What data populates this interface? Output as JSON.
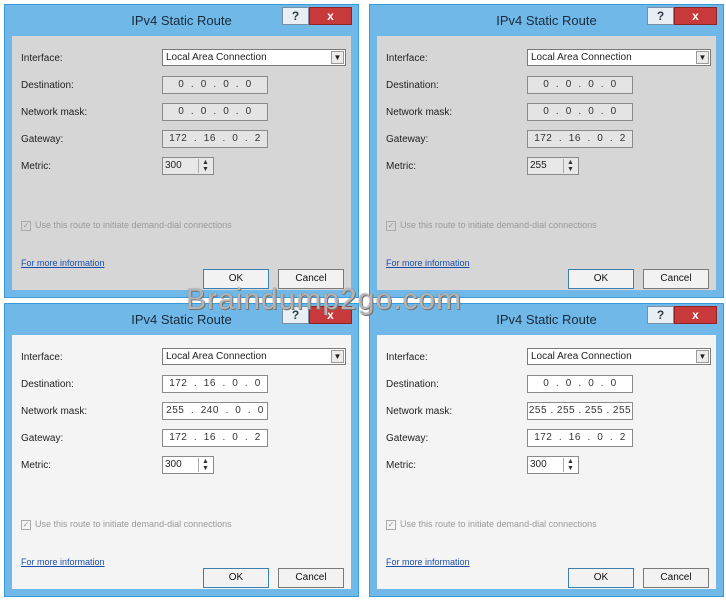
{
  "watermark": "Braindump2go.com",
  "labels": {
    "interface": "Interface:",
    "destination": "Destination:",
    "network_mask": "Network mask:",
    "gateway": "Gateway:",
    "metric": "Metric:",
    "checkbox": "Use this route to initiate demand-dial connections",
    "more_info": "For more information",
    "ok": "OK",
    "cancel": "Cancel",
    "help": "?",
    "close": "x"
  },
  "dialogs": [
    {
      "title": "IPv4 Static Route",
      "interface": "Local Area Connection",
      "destination": "0  .  0  .  0  .  0",
      "network_mask": "0  .  0  .  0  .  0",
      "gateway": "172  .  16  .  0  .  2",
      "metric": "300"
    },
    {
      "title": "IPv4 Static Route",
      "interface": "Local Area Connection",
      "destination": "0  .  0  .  0  .  0",
      "network_mask": "0  .  0  .  0  .  0",
      "gateway": "172  .  16  .  0  .  2",
      "metric": "255"
    },
    {
      "title": "IPv4 Static Route",
      "interface": "Local Area Connection",
      "destination": "172  .  16  .  0  .  0",
      "network_mask": "255  .  240  .  0  .  0",
      "gateway": "172  .  16  .  0  .  2",
      "metric": "300"
    },
    {
      "title": "IPv4 Static Route",
      "interface": "Local Area Connection",
      "destination": "0  .  0  .  0  .  0",
      "network_mask": "255 . 255 . 255 . 255",
      "gateway": "172  .  16  .  0  .  2",
      "metric": "300"
    }
  ]
}
